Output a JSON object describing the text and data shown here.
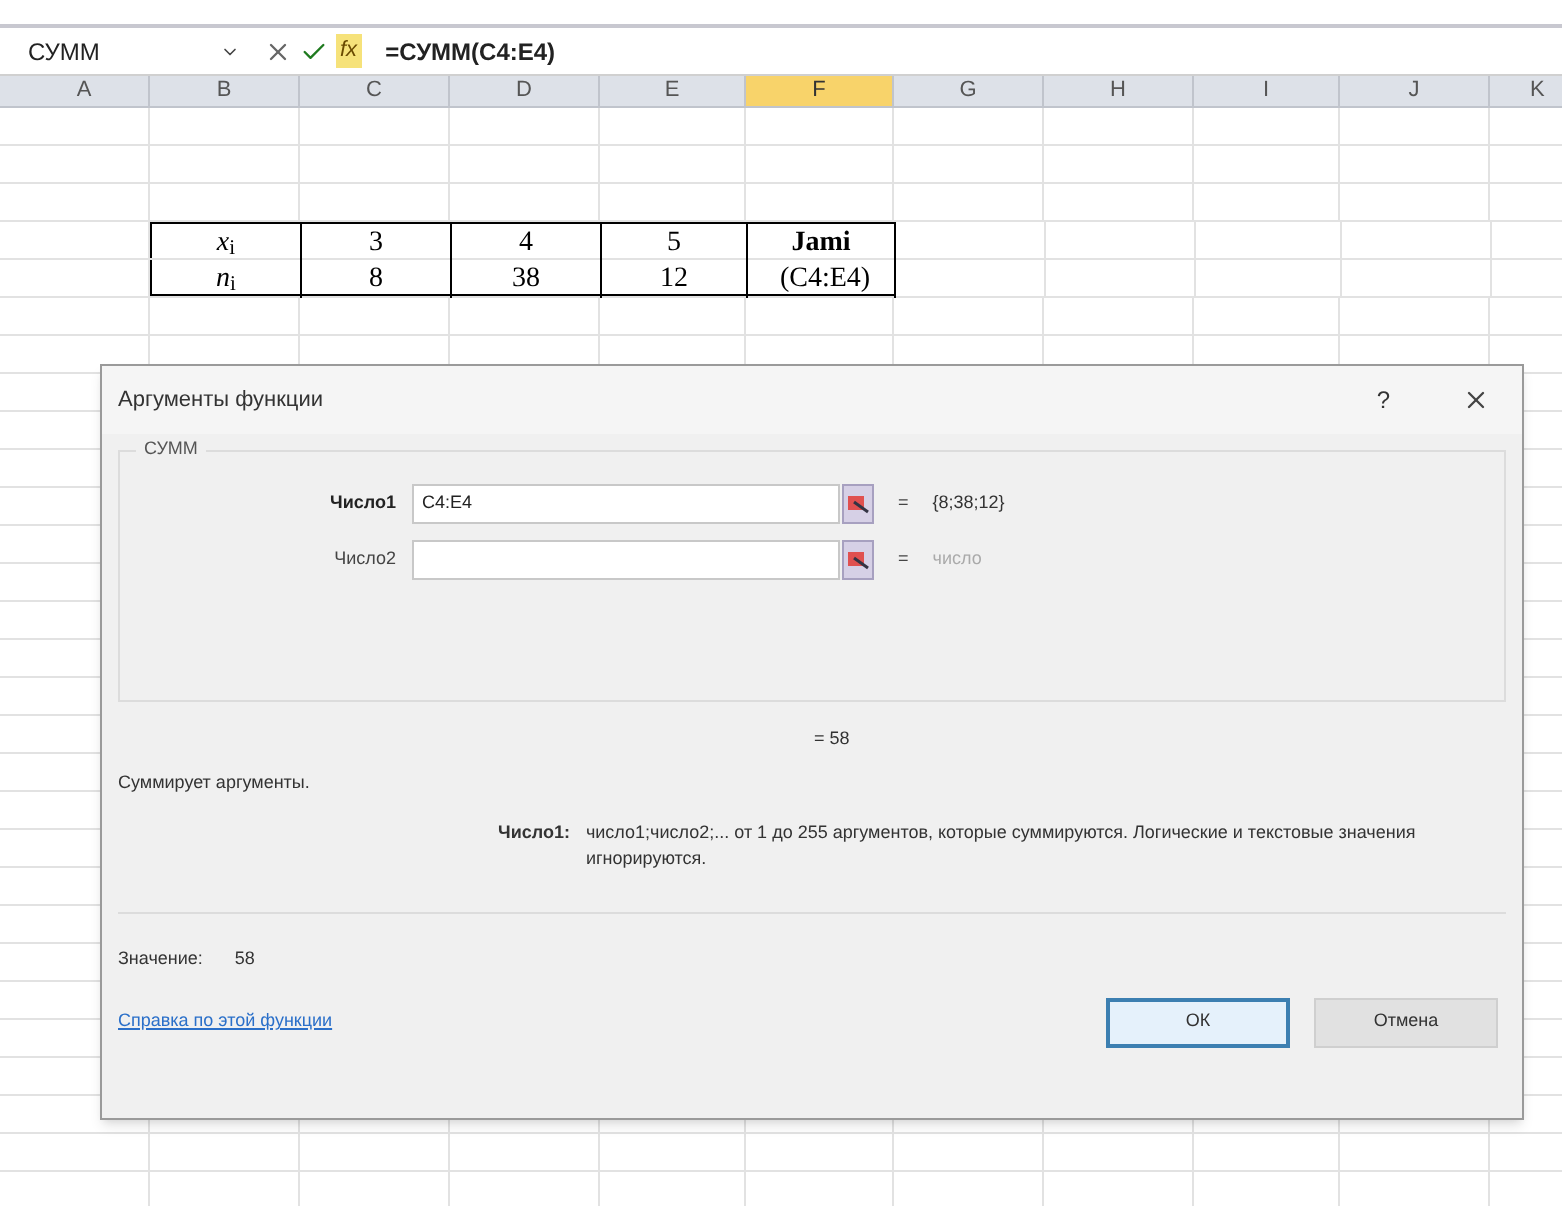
{
  "formula_bar": {
    "name_box": "СУММ",
    "fx": "fx",
    "formula": "=СУММ(C4:E4)"
  },
  "sheet": {
    "columns": [
      {
        "label": "A",
        "selected": false
      },
      {
        "label": "B",
        "selected": false
      },
      {
        "label": "C",
        "selected": false
      },
      {
        "label": "D",
        "selected": false
      },
      {
        "label": "E",
        "selected": false
      },
      {
        "label": "F",
        "selected": true
      },
      {
        "label": "G",
        "selected": false
      },
      {
        "label": "H",
        "selected": false
      },
      {
        "label": "I",
        "selected": false
      },
      {
        "label": "J",
        "selected": false
      },
      {
        "label": "K",
        "selected": false
      }
    ],
    "table_rows": [
      [
        {
          "kind": "label",
          "text": "*x*$_{i}$"
        },
        {
          "kind": "value",
          "text": "3"
        },
        {
          "kind": "value",
          "text": "4"
        },
        {
          "kind": "value",
          "text": "5"
        },
        {
          "kind": "heading",
          "text": "Jami"
        }
      ],
      [
        {
          "kind": "label",
          "text": "*n*$_{i}$"
        },
        {
          "kind": "value",
          "text": "8"
        },
        {
          "kind": "value",
          "text": "38"
        },
        {
          "kind": "value",
          "text": "12"
        },
        {
          "kind": "formula",
          "text": "(C4:E4)"
        }
      ]
    ]
  },
  "dialog": {
    "title": "Аргументы функции",
    "help": "?",
    "function_name": "СУММ",
    "arguments": [
      {
        "label": "Число1",
        "value": "C4:E4",
        "equals": "=",
        "result": "{8;38;12}",
        "active": true
      },
      {
        "label": "Число2",
        "equals": "=",
        "result": "число",
        "active": false
      }
    ],
    "total": "= 58",
    "description": "Суммирует аргументы.",
    "argument_help_label": "Число1:",
    "argument_help": "число1;число2;... от 1 до 255 аргументов, которые суммируются. Логические и текстовые значения игнорируются.",
    "value_label": "Значение:",
    "value": "58",
    "help_link": "Справка по этой функции",
    "buttons": [
      {
        "label": "ОК",
        "selected": true
      },
      {
        "label": "Отмена",
        "selected": false
      }
    ]
  }
}
